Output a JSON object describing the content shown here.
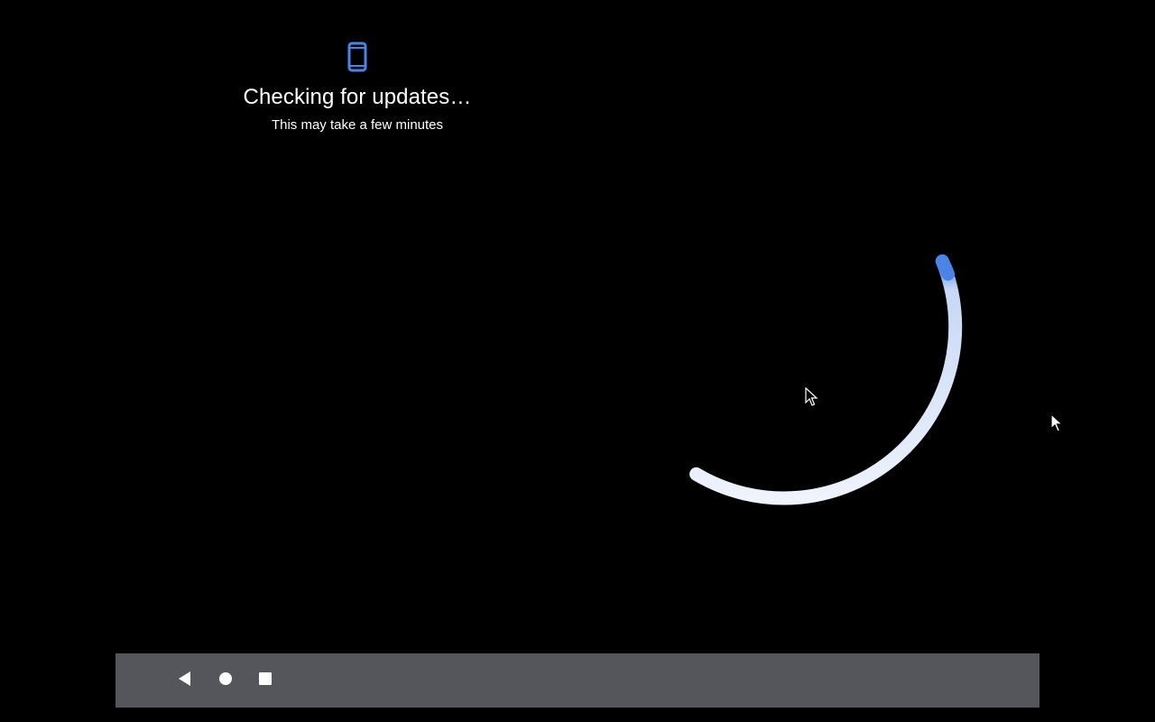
{
  "screen": {
    "icon": "phone-icon",
    "title": "Checking for updates…",
    "subtitle": "This may take a few minutes"
  },
  "spinner": {
    "icon": "progress-spinner",
    "accent_color": "#4a84e6",
    "track_color": "#e8eefb"
  },
  "navbar": {
    "back_icon": "back-triangle-icon",
    "home_icon": "home-circle-icon",
    "recents_icon": "recents-square-icon",
    "background": "#54565b"
  },
  "colors": {
    "background": "#000000",
    "text": "#ffffff",
    "accent": "#4a84e6"
  }
}
